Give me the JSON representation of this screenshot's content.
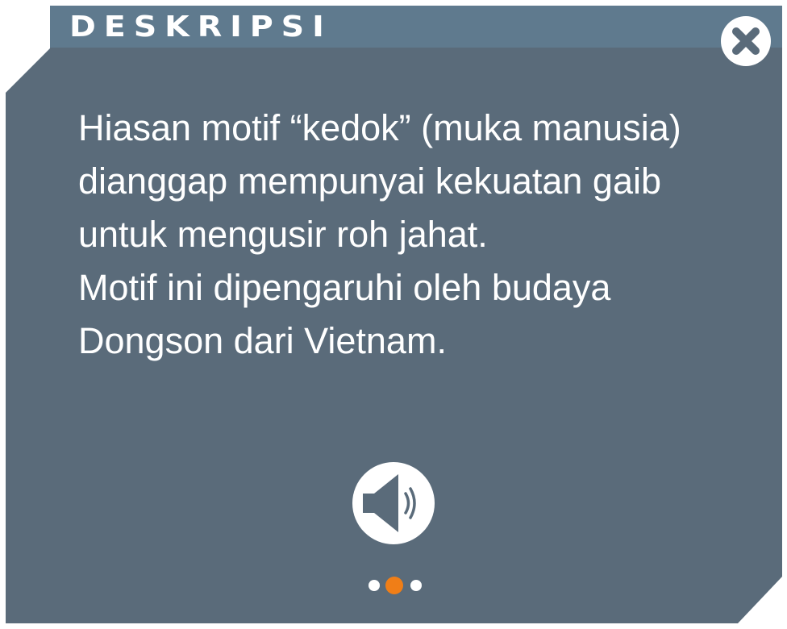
{
  "dialog": {
    "title": "DESKRIPSI",
    "paragraphs": [
      "Hiasan motif “kedok” (muka manusia) dianggap mempunyai kekuatan gaib untuk mengusir roh jahat.",
      "Motif ini dipengaruhi oleh budaya Dongson dari Vietnam."
    ],
    "close_icon": "close-x-icon",
    "audio_icon": "speaker-icon"
  },
  "pagination": {
    "total": 3,
    "current": 2
  },
  "colors": {
    "panel": "#5a6b7a",
    "title_bar": "#5f7a8e",
    "text": "#ffffff",
    "active_dot": "#f07e17"
  }
}
